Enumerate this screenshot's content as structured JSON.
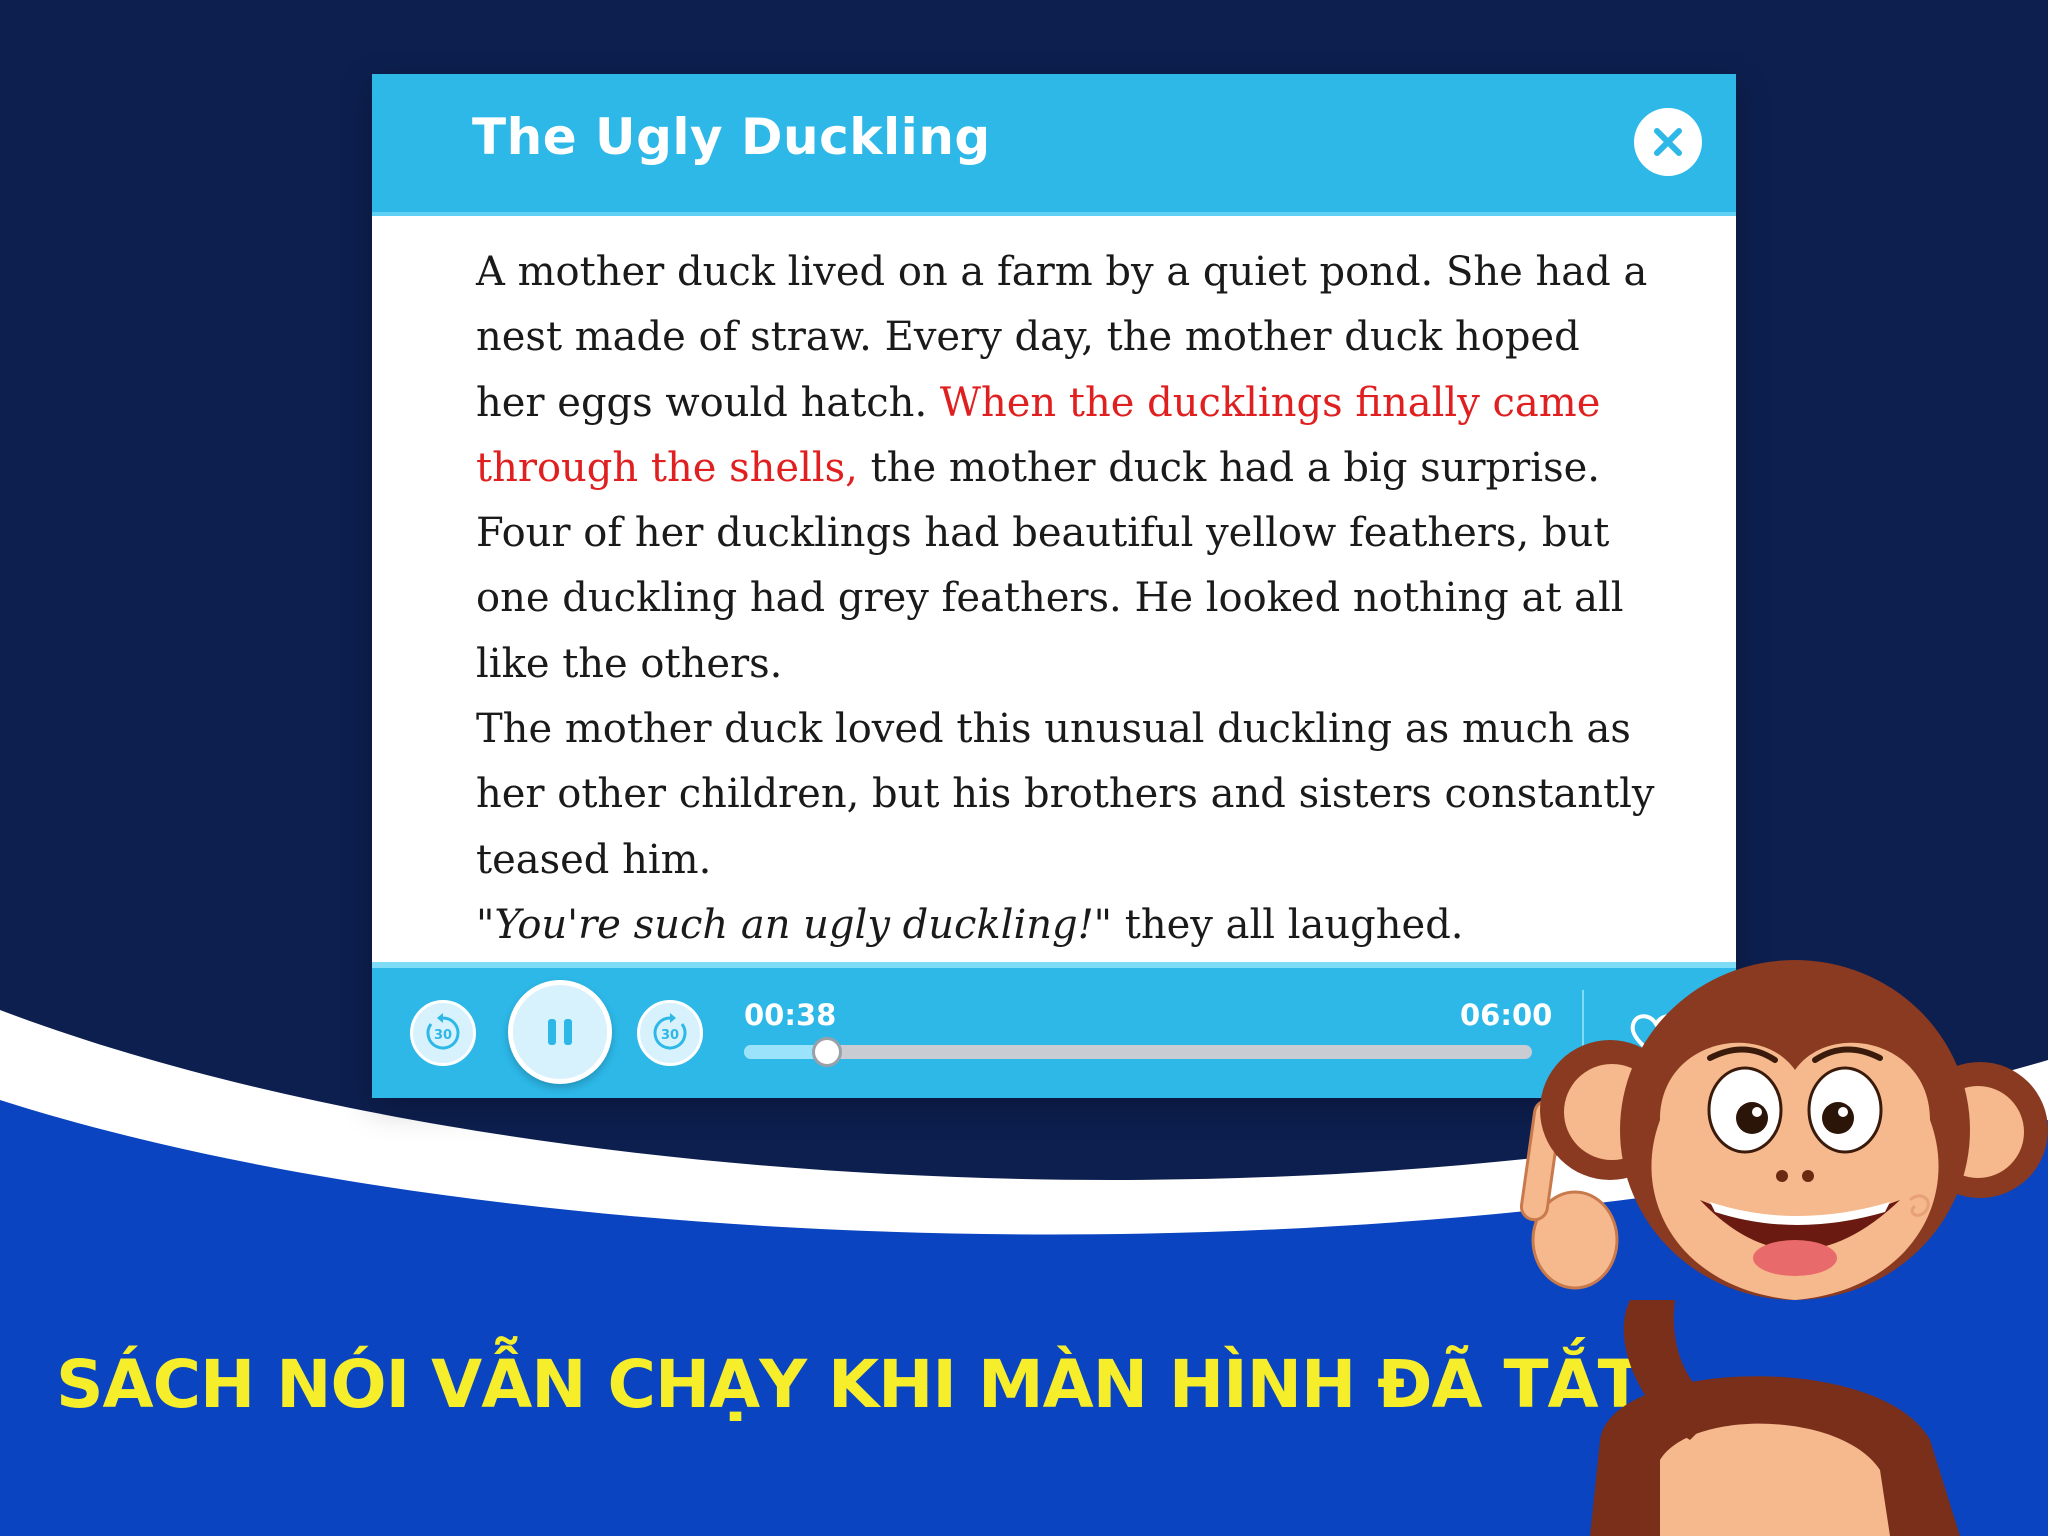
{
  "reader": {
    "title": "The Ugly Duckling",
    "close_icon": "close-icon",
    "paragraphs": [
      {
        "before": "A mother duck lived on a farm by a quiet pond. She had a nest made of straw. Every day, the mother duck hoped her eggs would hatch. ",
        "highlight": "When the ducklings finally came through the shells,",
        "after": " the mother duck had a big surprise. Four of her ducklings had beautiful yellow feathers, but one duckling had grey feathers. He looked nothing at all like the others."
      },
      {
        "text": "The mother duck loved this unusual duckling as much as her other children, but his brothers and sisters constantly teased him."
      },
      {
        "quote": "\"You're such an ugly duckling!\"",
        "after": " they all laughed."
      }
    ],
    "highlight_color": "#e02020"
  },
  "player": {
    "rewind_label": "30",
    "forward_label": "30",
    "current_time": "00:38",
    "total_time": "06:00",
    "progress": 0.105,
    "state_icon": "pause-icon",
    "favorite_icon": "heart-icon"
  },
  "caption": "SÁCH NÓI VẪN CHẠY KHI MÀN HÌNH ĐÃ TẮT",
  "colors": {
    "navy": "#0d1f4f",
    "blue": "#0a44c0",
    "header": "#2db8e8",
    "caption": "#f6ee2b"
  }
}
